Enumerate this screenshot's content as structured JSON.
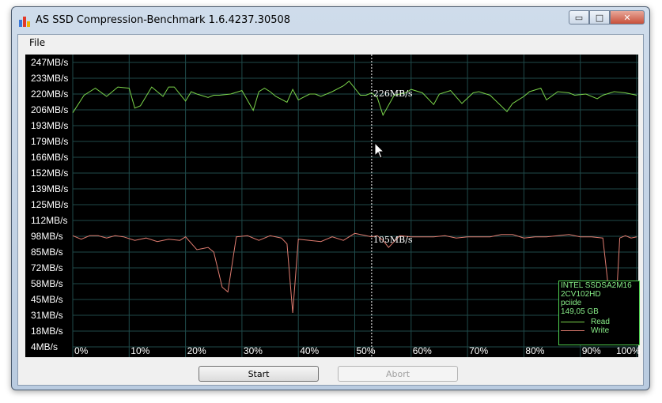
{
  "window": {
    "title": "AS SSD Compression-Benchmark 1.6.4237.30508",
    "caption": {
      "minimize": "▭",
      "maximize": "□",
      "close": "✕"
    }
  },
  "menu": {
    "file": "File"
  },
  "chart_data": {
    "type": "line",
    "title": "",
    "xlabel": "",
    "ylabel": "",
    "y_tick_labels": [
      "247MB/s",
      "233MB/s",
      "220MB/s",
      "206MB/s",
      "193MB/s",
      "179MB/s",
      "166MB/s",
      "152MB/s",
      "139MB/s",
      "125MB/s",
      "112MB/s",
      "98MB/s",
      "85MB/s",
      "72MB/s",
      "58MB/s",
      "45MB/s",
      "31MB/s",
      "18MB/s",
      "4MB/s"
    ],
    "x_tick_labels": [
      "0%",
      "10%",
      "20%",
      "30%",
      "40%",
      "50%",
      "60%",
      "70%",
      "80%",
      "90%",
      "100%"
    ],
    "xlim": [
      0,
      100
    ],
    "ylim": [
      4,
      247
    ],
    "grid": true,
    "marker": {
      "x": 53,
      "read_label": "226MB/s",
      "write_label": "105MB/s"
    },
    "series": [
      {
        "name": "Read",
        "color": "#7ad34a",
        "x": [
          0,
          2,
          4,
          6,
          8,
          10,
          11,
          12,
          14,
          16,
          17,
          18,
          20,
          21,
          22,
          24,
          25,
          26,
          28,
          30,
          32,
          33,
          34,
          35,
          36,
          38,
          39,
          40,
          42,
          43,
          44,
          46,
          48,
          49,
          51,
          52,
          53,
          54,
          55,
          57,
          59,
          60,
          62,
          64,
          65,
          67,
          69,
          71,
          72,
          74,
          77,
          78,
          80,
          81,
          83,
          84,
          86,
          88,
          89,
          91,
          93,
          94,
          96,
          98,
          100
        ],
        "y": [
          204,
          219,
          225,
          218,
          226,
          225,
          208,
          210,
          226,
          218,
          226,
          226,
          214,
          222,
          220,
          217,
          219,
          219,
          220,
          223,
          206,
          222,
          225,
          222,
          218,
          213,
          224,
          215,
          220,
          220,
          218,
          222,
          227,
          231,
          219,
          219,
          221,
          217,
          202,
          219,
          221,
          224,
          221,
          211,
          220,
          223,
          212,
          221,
          222,
          219,
          205,
          212,
          218,
          222,
          225,
          215,
          222,
          221,
          219,
          220,
          216,
          219,
          222,
          221,
          219
        ]
      },
      {
        "name": "Write",
        "color": "#e07c70",
        "x": [
          0,
          1.5,
          3,
          4.5,
          6,
          7.5,
          9,
          11,
          13,
          15,
          17,
          19,
          20,
          22,
          24,
          25,
          26.5,
          27.5,
          29,
          31,
          33,
          35,
          37,
          38,
          39,
          40,
          42,
          44,
          46,
          48,
          50,
          52,
          53,
          54,
          55,
          56,
          58,
          60,
          62,
          64,
          66,
          68,
          70,
          72,
          74,
          76,
          78,
          80,
          82,
          84,
          86,
          88,
          90,
          92,
          94,
          96,
          97,
          98,
          99,
          100
        ],
        "y": [
          99,
          96,
          99,
          99,
          97,
          99,
          98,
          95,
          97,
          94,
          96,
          95,
          98,
          87,
          89,
          85,
          55,
          51,
          98,
          99,
          95,
          99,
          97,
          92,
          33,
          96,
          95,
          94,
          98,
          95,
          101,
          99,
          98,
          99,
          95,
          89,
          99,
          98,
          98,
          98,
          99,
          97,
          98,
          98,
          98,
          100,
          100,
          97,
          98,
          98,
          99,
          100,
          98,
          98,
          97,
          10,
          97,
          99,
          97,
          98
        ]
      }
    ],
    "legend": {
      "position": "bottom-right",
      "info_lines": [
        "INTEL SSDSA2M16",
        "2CV102HD",
        "pciide",
        "149,05 GB"
      ],
      "entries": [
        "Read",
        "Write"
      ]
    }
  },
  "buttons": {
    "start": "Start",
    "abort": "Abort"
  }
}
